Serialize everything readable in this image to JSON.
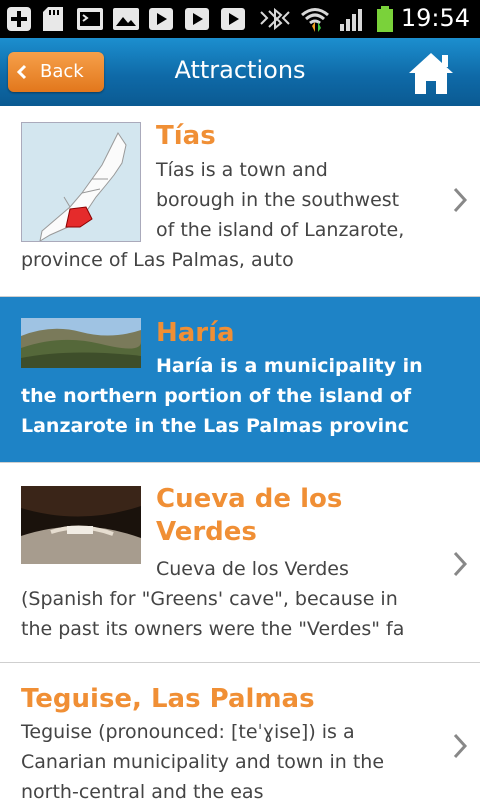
{
  "status_bar": {
    "time": "19:54",
    "icons": [
      "add-icon",
      "sd-card-icon",
      "terminal-icon",
      "image-icon",
      "play-store-icon",
      "play-store-icon",
      "play-store-icon",
      "bluetooth-vibrate-icon",
      "wifi-icon",
      "signal-icon",
      "battery-icon"
    ]
  },
  "header": {
    "back_label": "Back",
    "title": "Attractions",
    "home_icon": "home-icon"
  },
  "items": [
    {
      "title": "Tías",
      "lines": [
        "Tías is a town and",
        "borough in the southwest",
        "of the island of Lanzarote,",
        "province of Las Palmas, auto"
      ],
      "thumbnail": "lanzarote-map-thumbnail",
      "selected": false
    },
    {
      "title": "Haría",
      "lines": [
        "Haría is a municipality in",
        "the northern portion of the island of",
        "Lanzarote in the Las Palmas provinc"
      ],
      "thumbnail": "valley-landscape-thumbnail",
      "selected": true
    },
    {
      "title_lines": [
        "Cueva de los",
        "Verdes"
      ],
      "lines": [
        "Cueva de los Verdes",
        "(Spanish for \"Greens' cave\", because in",
        "the past its owners were the \"Verdes\" fa"
      ],
      "thumbnail": "cave-thumbnail",
      "selected": false
    },
    {
      "title": "Teguise, Las Palmas",
      "lines": [
        "Teguise (pronounced: [teˈɣise]) is a",
        "Canarian municipality and town in the",
        "north-central and the eas"
      ],
      "selected": false
    }
  ],
  "colors": {
    "accent_orange": "#f08f35",
    "header_blue": "#0f6aa8",
    "selected_blue": "#1e83c6"
  }
}
